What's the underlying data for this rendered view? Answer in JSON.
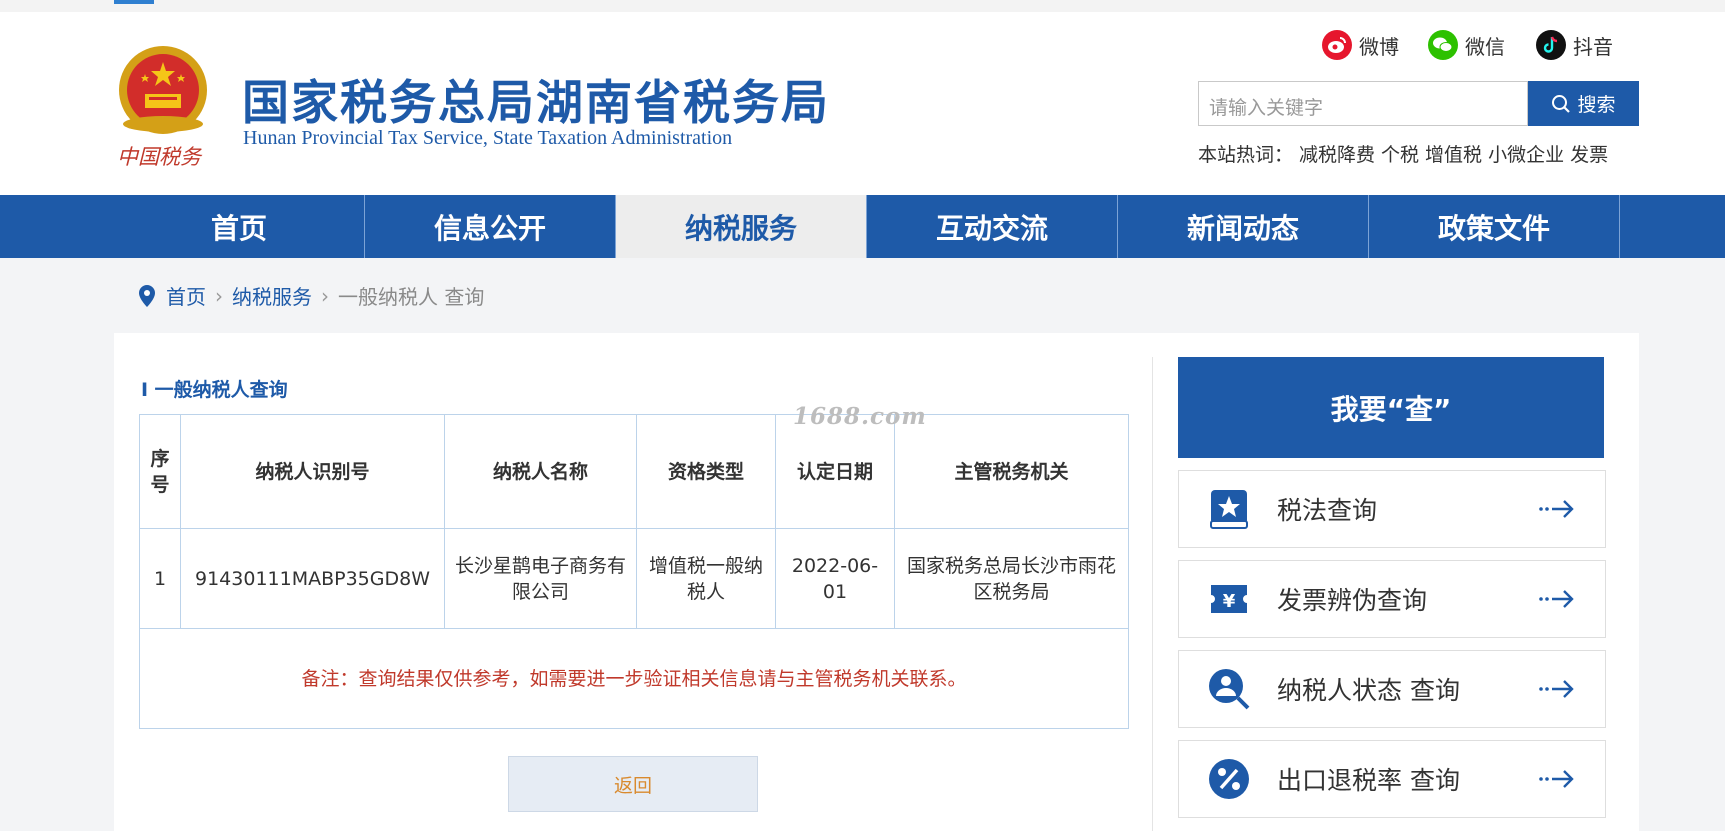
{
  "header": {
    "title": "国家税务总局湖南省税务局",
    "subtitle": "Hunan Provincial  Tax Service,  State Taxation Administration",
    "emblem_text": "中国税务",
    "social": [
      {
        "label": "微博",
        "icon": "weibo-icon",
        "color": "#e6162d"
      },
      {
        "label": "微信",
        "icon": "wechat-icon",
        "color": "#2dc100"
      },
      {
        "label": "抖音",
        "icon": "douyin-icon",
        "color": "#111111"
      }
    ],
    "search": {
      "placeholder": "请输入关键字",
      "button_label": "搜索"
    },
    "hot": {
      "label": "本站热词：",
      "words": [
        "减税降费",
        "个税",
        "增值税",
        "小微企业",
        "发票"
      ]
    }
  },
  "nav": {
    "items": [
      {
        "label": "首页",
        "active": false
      },
      {
        "label": "信息公开",
        "active": false
      },
      {
        "label": "纳税服务",
        "active": true
      },
      {
        "label": "互动交流",
        "active": false
      },
      {
        "label": "新闻动态",
        "active": false
      },
      {
        "label": "政策文件",
        "active": false
      }
    ]
  },
  "breadcrumb": {
    "items": [
      "首页",
      "纳税服务",
      "一般纳税人 查询"
    ],
    "separator": "›"
  },
  "main": {
    "section_title": "I 一般纳税人查询",
    "watermark": "1688.com",
    "table": {
      "headers": [
        "序号",
        "纳税人识别号",
        "纳税人名称",
        "资格类型",
        "认定日期",
        "主管税务机关"
      ],
      "rows": [
        [
          "1",
          "91430111MABP35GD8W",
          "长沙星鹊电子商务有限公司",
          "增值税一般纳税人",
          "2022-06-01",
          "国家税务总局长沙市雨花区税务局"
        ]
      ],
      "note": "备注：查询结果仅供参考，如需要进一步验证相关信息请与主管税务机关联系。"
    },
    "back_label": "返回"
  },
  "sidebar": {
    "title": "我要“查”",
    "items": [
      {
        "label": "税法查询",
        "icon": "law-book-icon"
      },
      {
        "label": "发票辨伪查询",
        "icon": "invoice-yuan-icon"
      },
      {
        "label": "纳税人状态 查询",
        "icon": "taxpayer-search-icon"
      },
      {
        "label": "出口退税率 查询",
        "icon": "percent-icon"
      }
    ]
  },
  "colors": {
    "brand_blue": "#1e5aa8",
    "note_red": "#c0392b",
    "back_text": "#d98a2e"
  }
}
